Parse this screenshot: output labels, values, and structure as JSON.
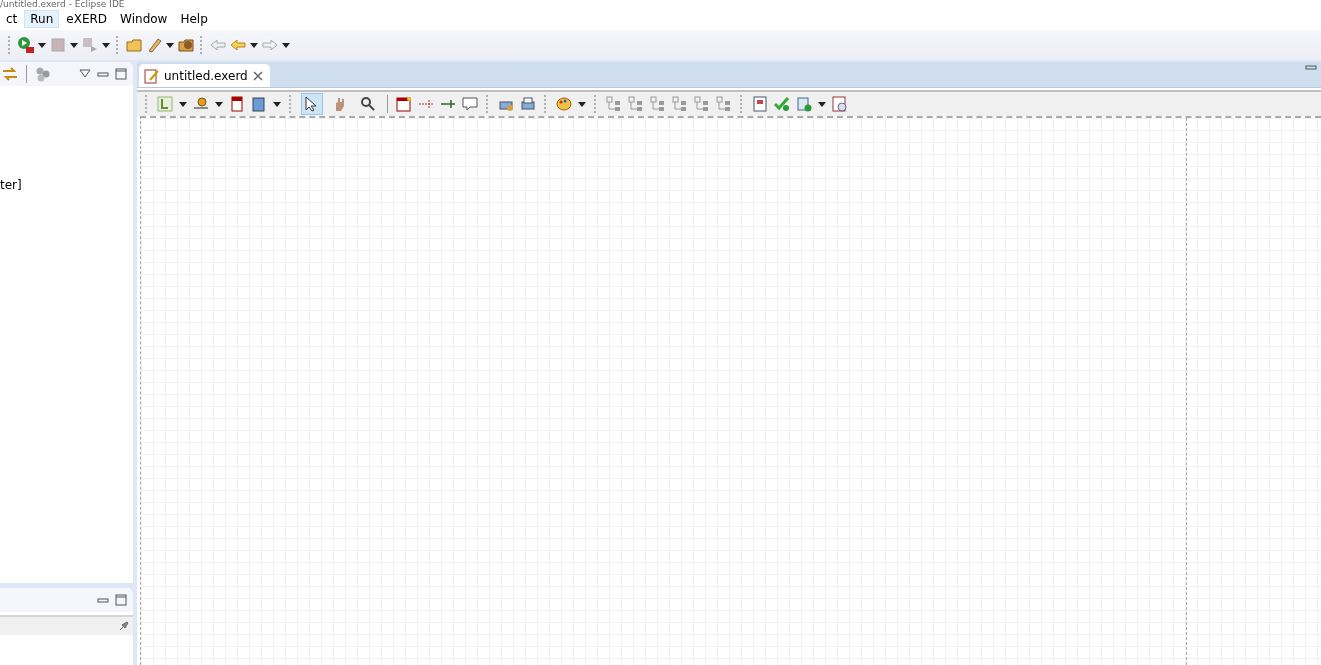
{
  "window": {
    "title": "/untitled.exerd - Eclipse IDE"
  },
  "menu": [
    {
      "label": "ct",
      "selected": false
    },
    {
      "label": "Run",
      "selected": true
    },
    {
      "label": "eXERD",
      "selected": false
    },
    {
      "label": "Window",
      "selected": false
    },
    {
      "label": "Help",
      "selected": false
    }
  ],
  "left_view": {
    "items": [
      "ter]"
    ]
  },
  "editor": {
    "tab": {
      "label": "untitled.exerd",
      "selected": true
    },
    "tools": [
      {
        "selected": true
      },
      {
        "selected": false
      },
      {
        "selected": false
      }
    ]
  }
}
